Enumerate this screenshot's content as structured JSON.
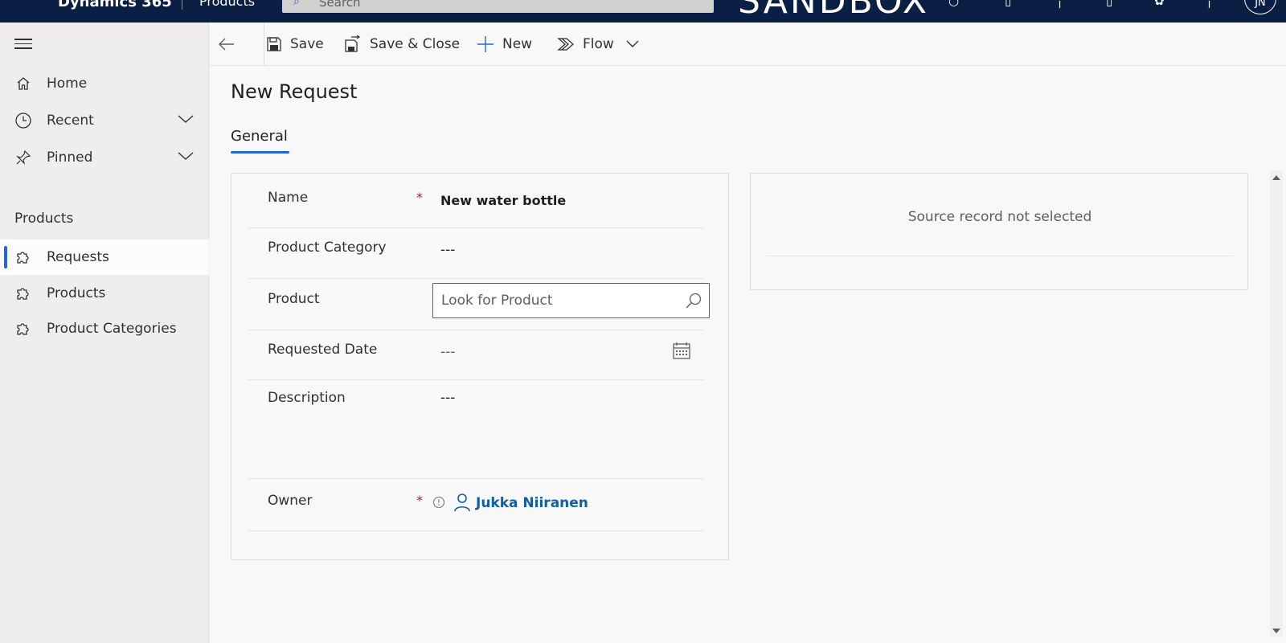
{
  "topbar": {
    "app_name": "Dynamics 365",
    "area_name": "Products",
    "search_placeholder": "Search",
    "environment_banner": "SANDBOX",
    "user_initials": "JN"
  },
  "sidebar": {
    "home": "Home",
    "recent": "Recent",
    "pinned": "Pinned",
    "section_title": "Products",
    "items": [
      {
        "label": "Requests",
        "active": true
      },
      {
        "label": "Products",
        "active": false
      },
      {
        "label": "Product Categories",
        "active": false
      }
    ]
  },
  "commandbar": {
    "save": "Save",
    "save_close": "Save & Close",
    "new": "New",
    "flow": "Flow"
  },
  "form": {
    "title": "New Request",
    "tab": "General",
    "fields": {
      "name": {
        "label": "Name",
        "required": "*",
        "value": "New water bottle"
      },
      "product_category": {
        "label": "Product Category",
        "value": "---"
      },
      "product": {
        "label": "Product",
        "placeholder": "Look for Product"
      },
      "requested_date": {
        "label": "Requested Date",
        "value": "---"
      },
      "description": {
        "label": "Description",
        "value": "---"
      },
      "owner": {
        "label": "Owner",
        "required": "*",
        "value": "Jukka Niiranen"
      }
    },
    "side_panel_message": "Source record not selected"
  },
  "colors": {
    "topbar_bg": "#0b1f45",
    "accent": "#2266e3",
    "link": "#115ea3",
    "required": "#a4262c"
  }
}
